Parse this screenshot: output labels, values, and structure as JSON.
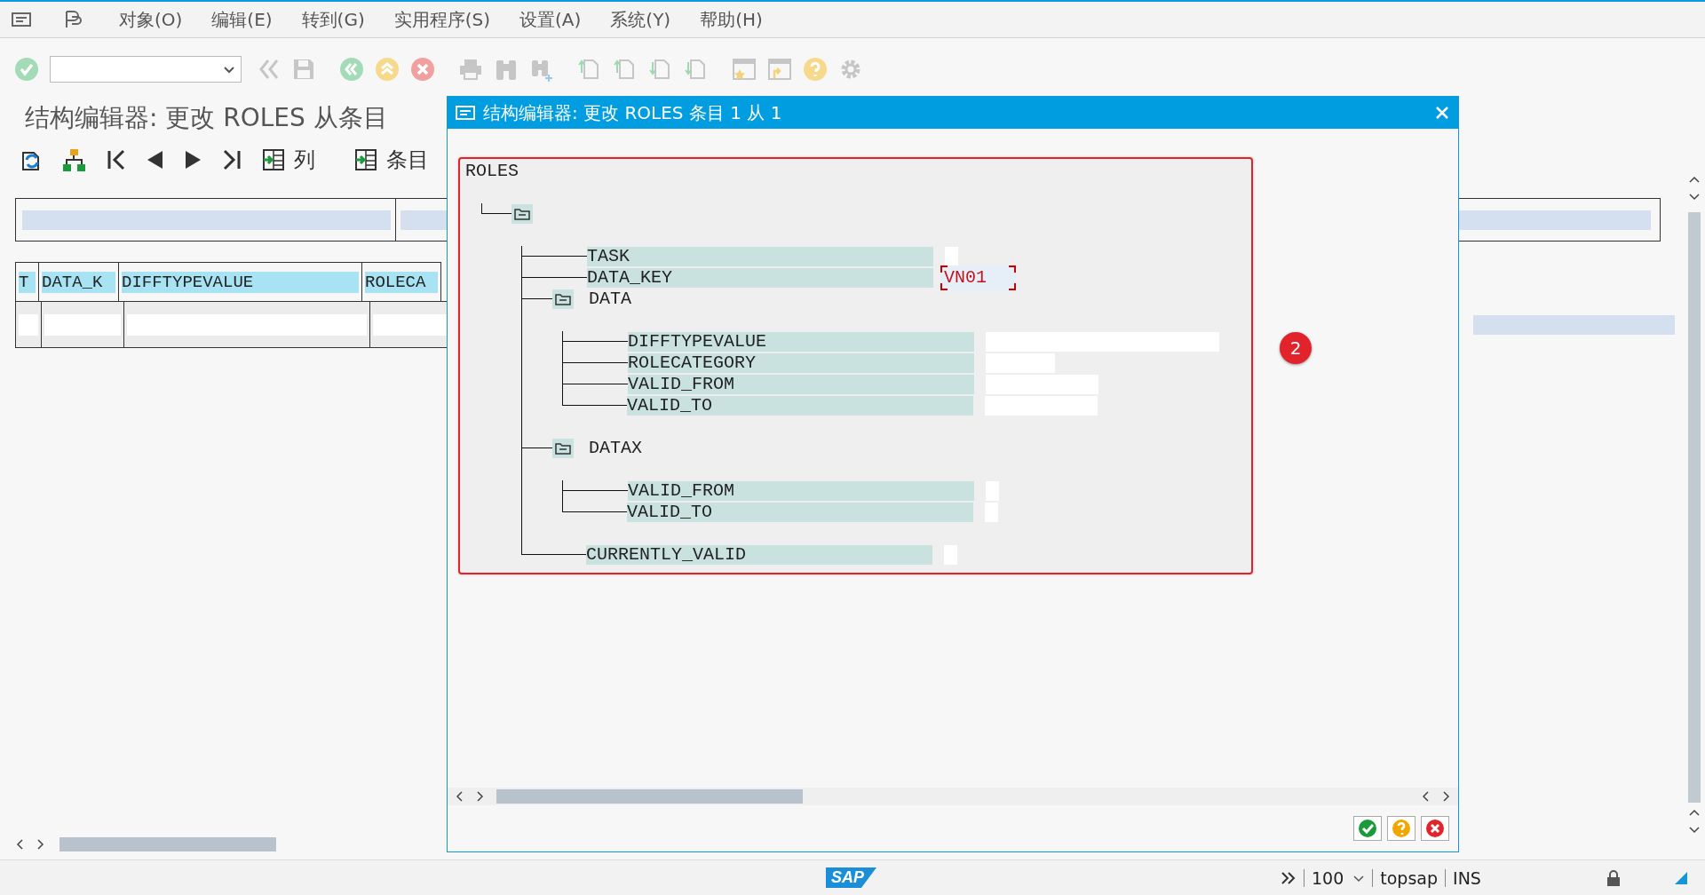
{
  "menu_bar": {
    "items": [
      "对象(O)",
      "编辑(E)",
      "转到(G)",
      "实用程序(S)",
      "设置(A)",
      "系统(Y)",
      "帮助(H)"
    ]
  },
  "screen_title": "结构编辑器: 更改 ROLES 从条目",
  "app_toolbar": {
    "buttons": [
      {
        "label": "列"
      },
      {
        "label": "条目"
      }
    ]
  },
  "table": {
    "columns": [
      "T",
      "DATA_K",
      "DIFFTYPEVALUE",
      "ROLECA"
    ]
  },
  "dialog": {
    "title": "结构编辑器: 更改 ROLES 条目 1 从 1",
    "badge": "2",
    "tree": {
      "label": "ROLES",
      "children": [
        {
          "kind": "folder",
          "children": [
            {
              "kind": "field",
              "label": "TASK",
              "focused": false
            },
            {
              "kind": "field",
              "label": "DATA_KEY",
              "value": "VN01",
              "focused": true
            },
            {
              "kind": "folder",
              "label": "DATA",
              "children": [
                {
                  "kind": "field",
                  "label": "DIFFTYPEVALUE",
                  "focused": false
                },
                {
                  "kind": "field",
                  "label": "ROLECATEGORY",
                  "focused": false
                },
                {
                  "kind": "field",
                  "label": "VALID_FROM",
                  "focused": false
                },
                {
                  "kind": "field",
                  "label": "VALID_TO",
                  "focused": false
                }
              ]
            },
            {
              "kind": "folder",
              "label": "DATAX",
              "children": [
                {
                  "kind": "field",
                  "label": "VALID_FROM",
                  "focused": false
                },
                {
                  "kind": "field",
                  "label": "VALID_TO",
                  "focused": false
                }
              ]
            },
            {
              "kind": "field",
              "label": "CURRENTLY_VALID",
              "focused": false
            }
          ]
        }
      ]
    }
  },
  "status_bar": {
    "logo": "SAP",
    "zoom": "100",
    "system": "topsap",
    "mode": "INS"
  }
}
